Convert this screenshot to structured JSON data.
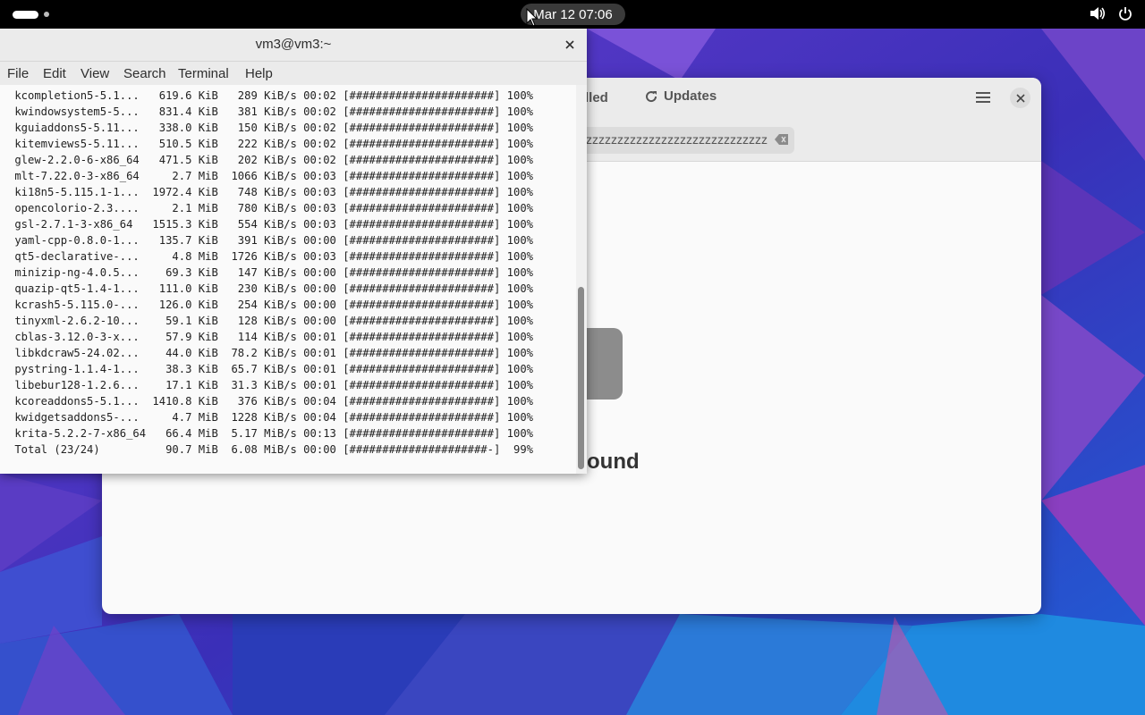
{
  "colors": {
    "topbar": "#000000",
    "terminal_bg": "#fafafa",
    "wallpaper_primary": "#4a2fb0",
    "wallpaper_secondary": "#2a6ad8"
  },
  "topbar": {
    "clock": "Mar 12  07:06",
    "activities_icon": "activities-icon",
    "volume_icon": "volume-icon",
    "power_icon": "power-icon"
  },
  "software_window": {
    "tab_installed_label": "lled",
    "tab_updates_label": "Updates",
    "search_value": "zzzzzzzzzzzzzzzzzzzzzzzzzzzzzzzzzzzz",
    "empty_title": "Found"
  },
  "terminal": {
    "title": "vm3@vm3:~",
    "menu": [
      "File",
      "Edit",
      "View",
      "Search",
      "Terminal",
      "Help"
    ],
    "lines": [
      " kcompletion5-5.1...   619.6 KiB   289 KiB/s 00:02 [######################] 100%",
      " kwindowsystem5-5...   831.4 KiB   381 KiB/s 00:02 [######################] 100%",
      " kguiaddons5-5.11...   338.0 KiB   150 KiB/s 00:02 [######################] 100%",
      " kitemviews5-5.11...   510.5 KiB   222 KiB/s 00:02 [######################] 100%",
      " glew-2.2.0-6-x86_64   471.5 KiB   202 KiB/s 00:02 [######################] 100%",
      " mlt-7.22.0-3-x86_64     2.7 MiB  1066 KiB/s 00:03 [######################] 100%",
      " ki18n5-5.115.1-1...  1972.4 KiB   748 KiB/s 00:03 [######################] 100%",
      " opencolorio-2.3....     2.1 MiB   780 KiB/s 00:03 [######################] 100%",
      " gsl-2.7.1-3-x86_64   1515.3 KiB   554 KiB/s 00:03 [######################] 100%",
      " yaml-cpp-0.8.0-1...   135.7 KiB   391 KiB/s 00:00 [######################] 100%",
      " qt5-declarative-...     4.8 MiB  1726 KiB/s 00:03 [######################] 100%",
      " minizip-ng-4.0.5...    69.3 KiB   147 KiB/s 00:00 [######################] 100%",
      " quazip-qt5-1.4-1...   111.0 KiB   230 KiB/s 00:00 [######################] 100%",
      " kcrash5-5.115.0-...   126.0 KiB   254 KiB/s 00:00 [######################] 100%",
      " tinyxml-2.6.2-10...    59.1 KiB   128 KiB/s 00:00 [######################] 100%",
      " cblas-3.12.0-3-x...    57.9 KiB   114 KiB/s 00:01 [######################] 100%",
      " libkdcraw5-24.02...    44.0 KiB  78.2 KiB/s 00:01 [######################] 100%",
      " pystring-1.1.4-1...    38.3 KiB  65.7 KiB/s 00:01 [######################] 100%",
      " libebur128-1.2.6...    17.1 KiB  31.3 KiB/s 00:01 [######################] 100%",
      " kcoreaddons5-5.1...  1410.8 KiB   376 KiB/s 00:04 [######################] 100%",
      " kwidgetsaddons5-...     4.7 MiB  1228 KiB/s 00:04 [######################] 100%",
      " krita-5.2.2-7-x86_64   66.4 MiB  5.17 MiB/s 00:13 [######################] 100%",
      " Total (23/24)          90.7 MiB  6.08 MiB/s 00:00 [#####################-]  99%"
    ]
  }
}
